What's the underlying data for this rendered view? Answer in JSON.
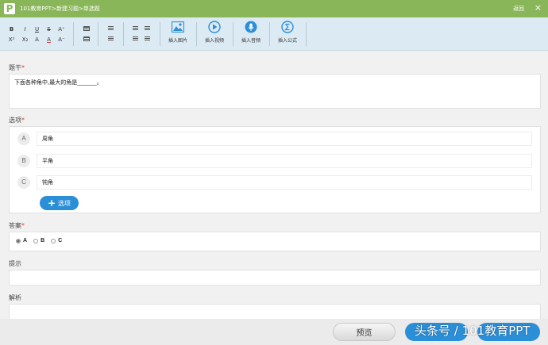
{
  "window": {
    "breadcrumb": "101教育PPT>新建习题>单选题",
    "back_label": "返回",
    "close_glyph": "×",
    "logo_letter": "P",
    "title_bar_color": "#8ab65a"
  },
  "toolbar": {
    "format_buttons": [
      "B",
      "I",
      "U",
      "S",
      "A⁺",
      "X²",
      "X₂",
      "A",
      "A",
      "A⁻"
    ],
    "insert_image": "插入图片",
    "insert_video": "插入视频",
    "insert_audio": "插入音频",
    "insert_formula": "插入公式",
    "icon_color": "#2b8fd8"
  },
  "stem": {
    "label": "题干",
    "required_mark": "*",
    "text": "下面各种角中,最大的角是_______。"
  },
  "options": {
    "label": "选项",
    "required_mark": "*",
    "items": [
      {
        "letter": "A",
        "text": "周角"
      },
      {
        "letter": "B",
        "text": "平角"
      },
      {
        "letter": "C",
        "text": "钝角"
      }
    ],
    "add_label": "选项",
    "add_icon": "plus-icon"
  },
  "answer": {
    "label": "答案",
    "required_mark": "*",
    "choices": [
      "A",
      "B",
      "C"
    ],
    "selected": "A"
  },
  "hint": {
    "label": "提示"
  },
  "analysis": {
    "label": "解析"
  },
  "footer": {
    "preview_label": "预览",
    "watermark": "头条号 / 101教育PPT",
    "accent_color": "#2b8fd8"
  }
}
